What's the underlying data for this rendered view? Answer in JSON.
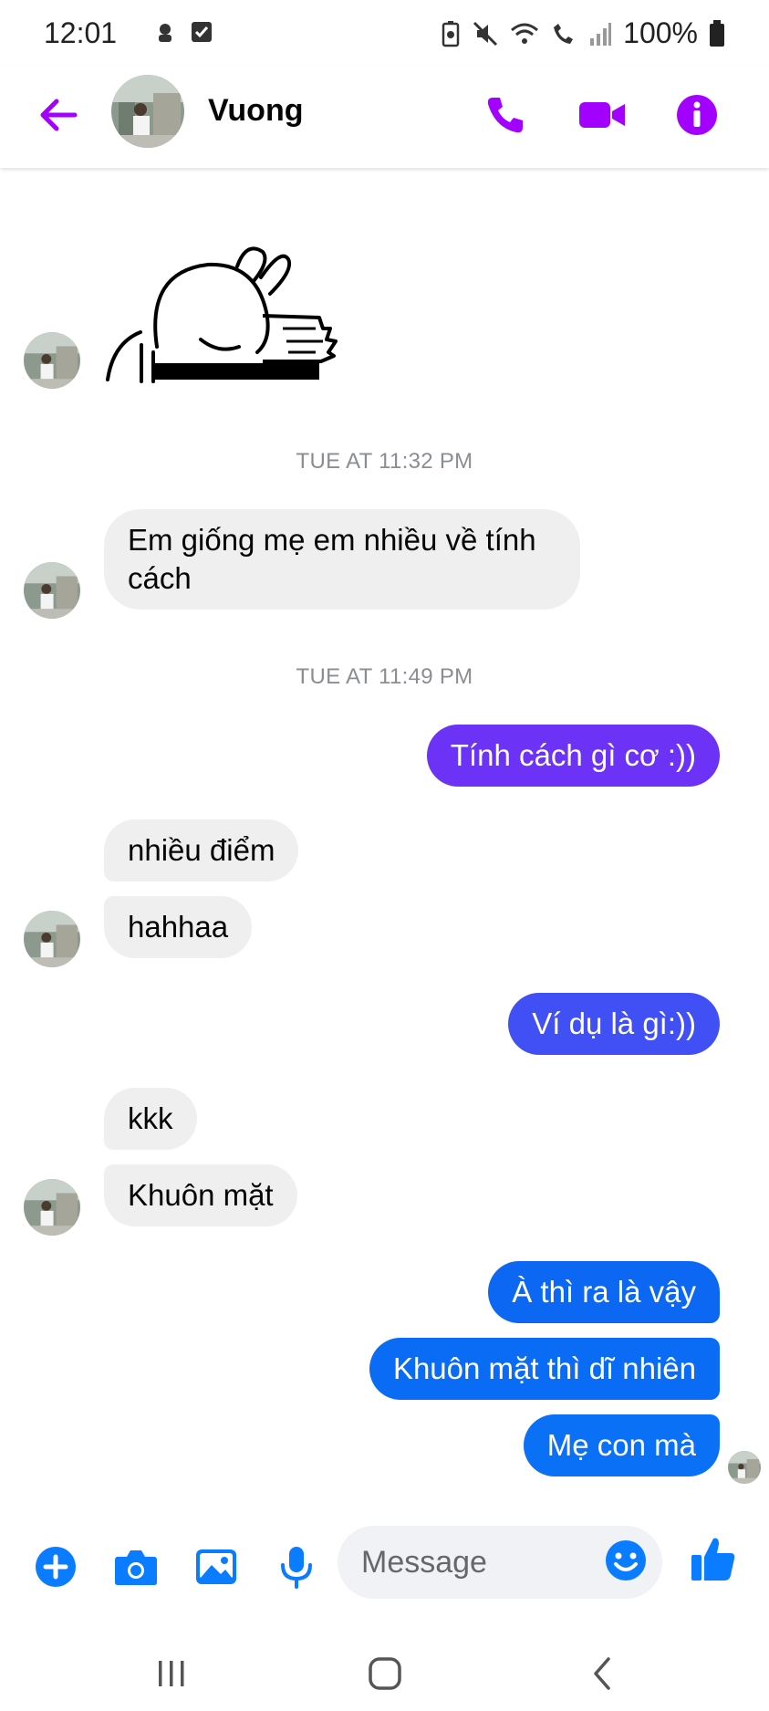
{
  "status_bar": {
    "time": "12:01",
    "battery": "100%"
  },
  "header": {
    "contact_name": "Vuong"
  },
  "colors": {
    "accent": "#a200ff",
    "bubble_purple": "#6c32f6",
    "bubble_indigo": "#4150f5",
    "bubble_blue": "#0a6cf5",
    "incoming": "#efeff0",
    "composer_blue": "#0a7cff"
  },
  "conversation": {
    "timestamps": [
      "TUE AT 11:32 PM",
      "TUE AT 11:49 PM"
    ],
    "messages": {
      "m1": "Em giống mẹ em nhiều về tính cách",
      "m2": "Tính cách gì cơ :))",
      "m3": "nhiều điểm",
      "m4": "hahhaa",
      "m5": "Ví dụ là gì:))",
      "m6": "kkk",
      "m7": "Khuôn mặt",
      "m8": "À thì ra là vậy",
      "m9": "Khuôn mặt thì dĩ nhiên",
      "m10": "Mẹ con mà"
    }
  },
  "composer": {
    "placeholder": "Message"
  }
}
